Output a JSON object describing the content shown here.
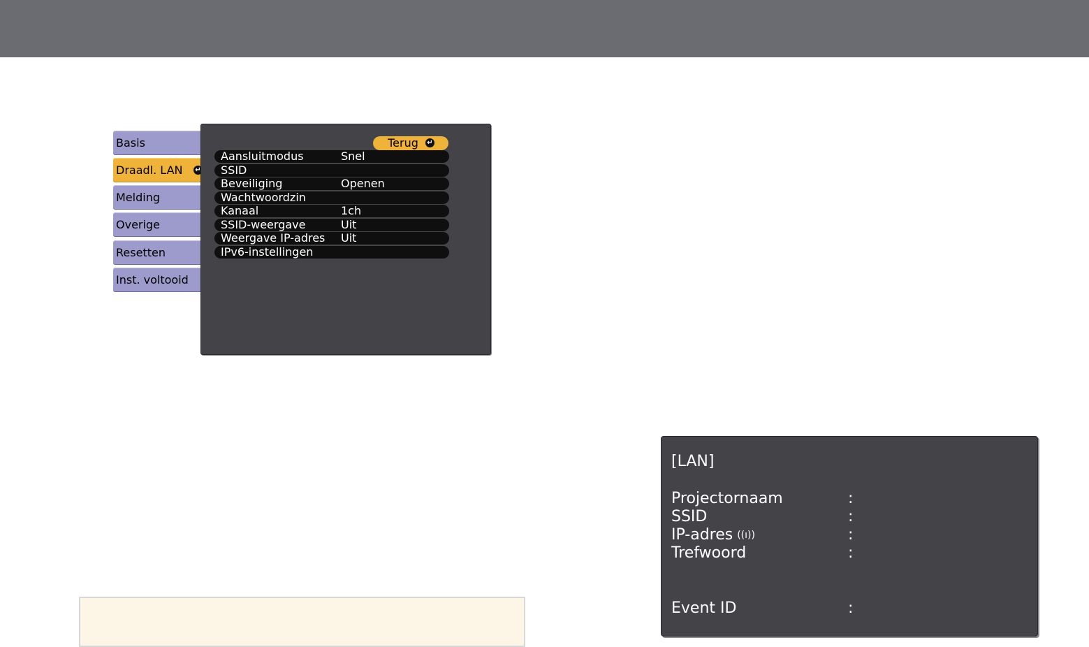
{
  "menu": {
    "tabs": [
      {
        "label": "Basis",
        "active": false
      },
      {
        "label": "Draadl. LAN",
        "active": true
      },
      {
        "label": "Melding",
        "active": false
      },
      {
        "label": "Overige",
        "active": false
      },
      {
        "label": "Resetten",
        "active": false
      },
      {
        "label": "Inst. voltooid",
        "active": false
      }
    ],
    "back_label": "Terug",
    "settings": [
      {
        "label": "Aansluitmodus",
        "value": "Snel"
      },
      {
        "label": "SSID",
        "value": ""
      },
      {
        "label": "Beveiliging",
        "value": "Openen"
      },
      {
        "label": "Wachtwoordzin",
        "value": ""
      },
      {
        "label": "Kanaal",
        "value": "1ch"
      },
      {
        "label": "SSID-weergave",
        "value": "Uit"
      },
      {
        "label": "Weergave IP-adres",
        "value": "Uit"
      },
      {
        "label": "IPv6-instellingen",
        "value": ""
      }
    ]
  },
  "lan_screen": {
    "title": "[LAN]",
    "fields": [
      {
        "label": "Projectornaam",
        "sep": ":"
      },
      {
        "label": "SSID",
        "sep": ":"
      },
      {
        "label": "IP-adres",
        "sep": ":",
        "icon": "wireless-signal-icon"
      },
      {
        "label": "Trefwoord",
        "sep": ":"
      },
      {
        "label": "Event ID",
        "sep": ":"
      }
    ]
  },
  "colors": {
    "header_bar": "#6a6c71",
    "tab_inactive": "#9d9bcb",
    "tab_active": "#f0b33a",
    "panel_bg": "#434348",
    "row_bg": "#0f0f10",
    "note_bg": "#fdf6e6"
  }
}
